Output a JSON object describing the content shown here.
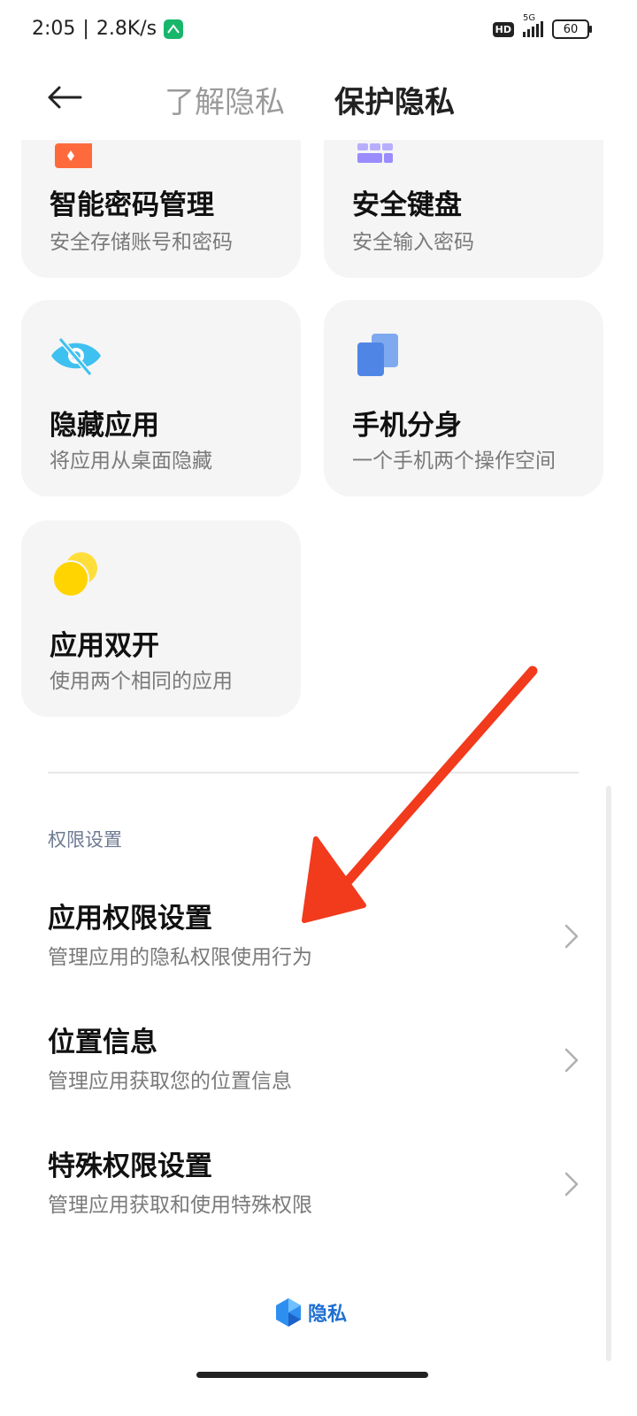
{
  "status": {
    "time": "2:05",
    "speed": "2.8K/s",
    "hd": "HD",
    "network": "5G",
    "battery": "60"
  },
  "header": {
    "back_icon": "arrow-left-icon",
    "tab_understand": "了解隐私",
    "tab_protect": "保护隐私"
  },
  "cards": {
    "password": {
      "title": "智能密码管理",
      "sub": "安全存储账号和密码",
      "icon": "lock-icon",
      "color": "#ff6a3d"
    },
    "keyboard": {
      "title": "安全键盘",
      "sub": "安全输入密码",
      "icon": "keyboard-icon",
      "color": "#9a8cff"
    },
    "hide_apps": {
      "title": "隐藏应用",
      "sub": "将应用从桌面隐藏",
      "icon": "eye-off-icon",
      "color": "#3ec1f0"
    },
    "second_space": {
      "title": "手机分身",
      "sub": "一个手机两个操作空间",
      "icon": "dual-pages-icon",
      "color": "#4f86e6"
    },
    "dual_apps": {
      "title": "应用双开",
      "sub": "使用两个相同的应用",
      "icon": "dual-circles-icon",
      "color": "#ffd400"
    }
  },
  "section": {
    "label": "权限设置"
  },
  "rows": [
    {
      "title": "应用权限设置",
      "sub": "管理应用的隐私权限使用行为"
    },
    {
      "title": "位置信息",
      "sub": "管理应用获取您的位置信息"
    },
    {
      "title": "特殊权限设置",
      "sub": "管理应用获取和使用特殊权限"
    }
  ],
  "brand": {
    "text": "隐私",
    "icon": "privacy-shield-icon"
  },
  "annotation": {
    "color": "#f23a1d"
  }
}
